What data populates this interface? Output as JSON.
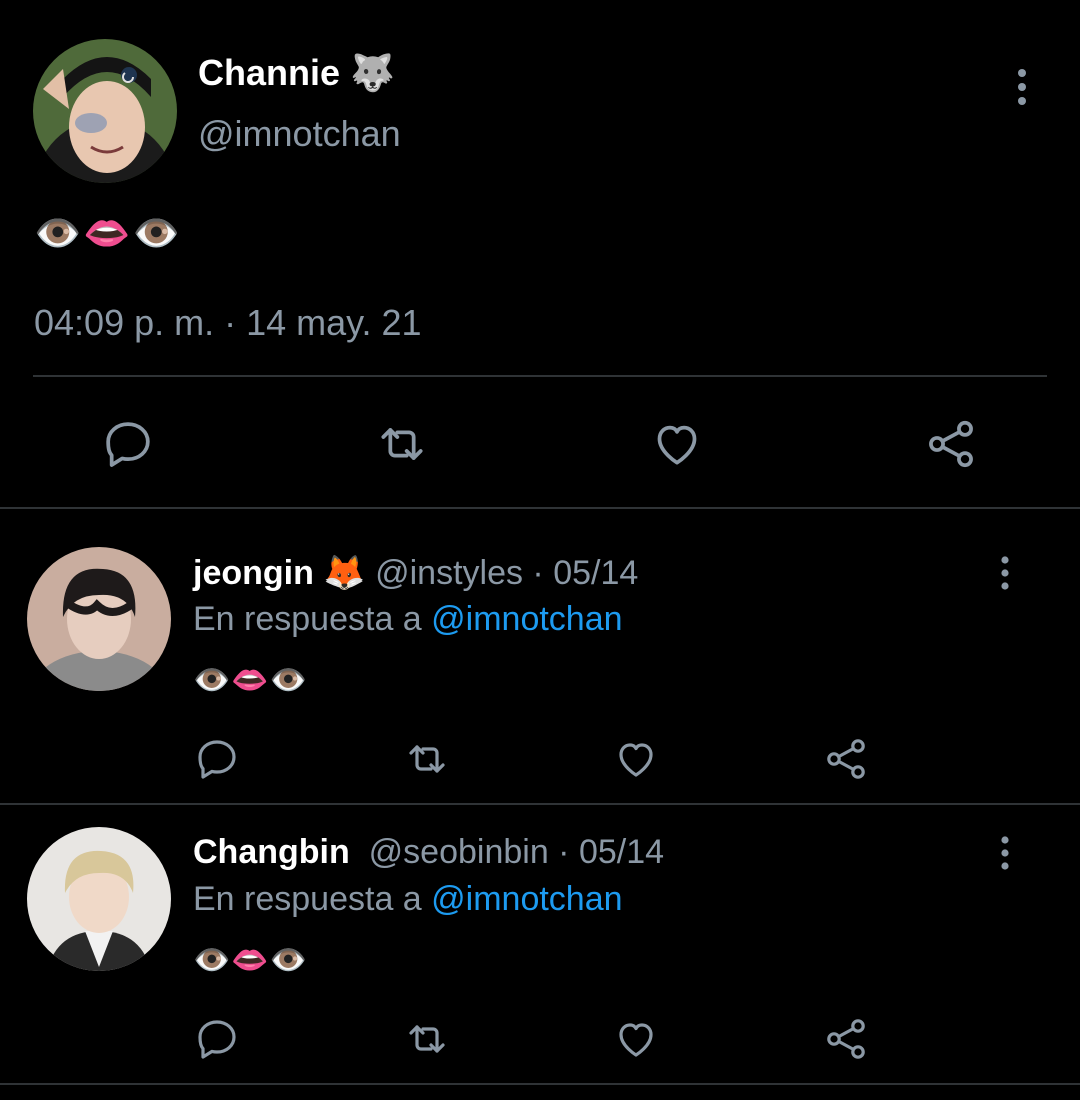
{
  "main_tweet": {
    "name": "Channie 🐺",
    "handle": "@imnotchan",
    "content": "👁️👄👁️",
    "timestamp": "04:09 p. m. · 14 may. 21"
  },
  "replies": [
    {
      "name": "jeongin 🦊",
      "handle_date": " @instyles · 05/14",
      "reply_prefix": "En respuesta a ",
      "mention": "@imnotchan",
      "content": "👁️👄👁️"
    },
    {
      "name": "Changbin",
      "handle_date": "  @seobinbin · 05/14",
      "reply_prefix": "En respuesta a ",
      "mention": "@imnotchan",
      "content": "👁️👄👁️"
    }
  ],
  "icons": {
    "actions": [
      "reply-icon",
      "retweet-icon",
      "like-icon",
      "share-icon"
    ],
    "more": "more-options-icon"
  },
  "colors": {
    "background": "#000000",
    "secondary_text": "#8b98a5",
    "link": "#1d9bf0",
    "divider": "#2f3336"
  }
}
